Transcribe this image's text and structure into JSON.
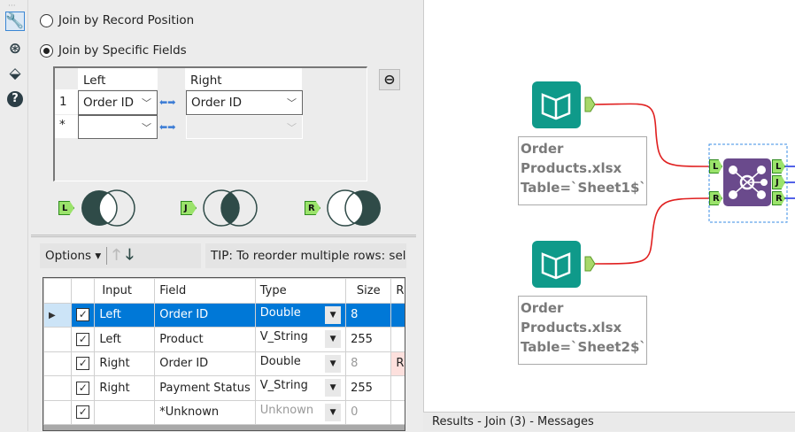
{
  "config": {
    "sidebar_icons": [
      "wrench-icon",
      "navigate-icon",
      "tag-icon",
      "help-icon"
    ],
    "join_options": [
      {
        "label": "Join by Record Position",
        "selected": false
      },
      {
        "label": "Join by Specific Fields",
        "selected": true
      }
    ],
    "join_fields": {
      "headers": {
        "left": "Left",
        "right": "Right"
      },
      "rows": [
        {
          "num": "1",
          "left": "Order ID",
          "right": "Order ID"
        },
        {
          "num": "*",
          "left": "",
          "right": ""
        }
      ]
    },
    "venn": [
      {
        "tag": "L"
      },
      {
        "tag": "J"
      },
      {
        "tag": "R"
      }
    ],
    "options_label": "Options",
    "tip": "TIP: To reorder multiple rows: selec",
    "grid": {
      "headers": [
        "Input",
        "Field",
        "Type",
        "Size",
        "R"
      ],
      "rows": [
        {
          "checked": true,
          "input": "Left",
          "field": "Order ID",
          "type": "Double",
          "size": "8",
          "rename": "",
          "selected": true
        },
        {
          "checked": true,
          "input": "Left",
          "field": "Product",
          "type": "V_String",
          "size": "255",
          "rename": ""
        },
        {
          "checked": true,
          "input": "Right",
          "field": "Order ID",
          "type": "Double",
          "size": "8",
          "rename": "R"
        },
        {
          "checked": true,
          "input": "Right",
          "field": "Payment Status",
          "type": "V_String",
          "size": "255",
          "rename": ""
        },
        {
          "checked": true,
          "input": "",
          "field": "*Unknown",
          "type": "Unknown",
          "size": "0",
          "rename": ""
        }
      ]
    }
  },
  "canvas": {
    "input1": {
      "annotation": "Order\nProducts.xlsx\nTable=`Sheet1$`"
    },
    "input2": {
      "annotation": "Order\nProducts.xlsx\nTable=`Sheet2$`"
    },
    "join": {
      "inputs": [
        "L",
        "R"
      ],
      "outputs": [
        "L",
        "J",
        "R"
      ]
    },
    "colors": {
      "input_tool": "#0f9a8a",
      "join_tool": "#6a4a8c",
      "connection": "#e02020",
      "output_conn": "#1a2ee0"
    }
  },
  "results_bar": "Results - Join (3) - Messages"
}
